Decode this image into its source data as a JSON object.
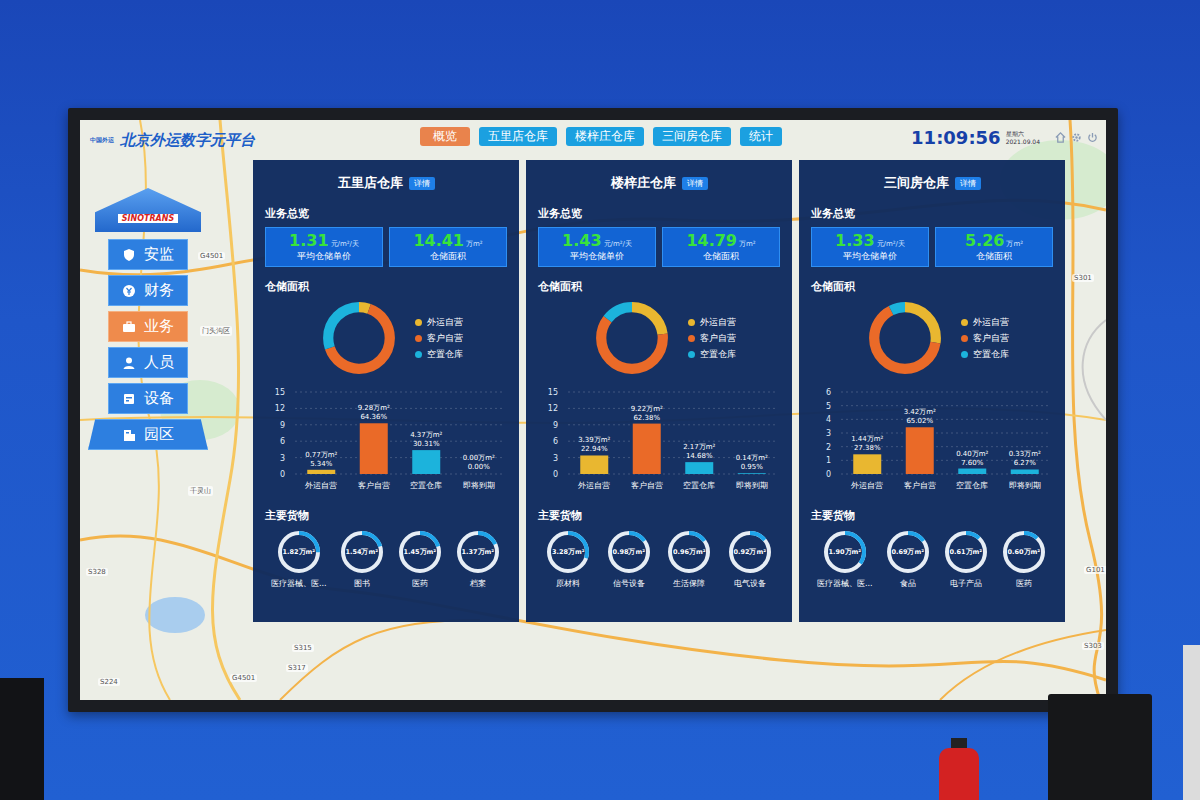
{
  "header": {
    "logo_text": "中国外运",
    "title": "北京外运数字元平台",
    "tabs": [
      {
        "label": "概览",
        "selected": true
      },
      {
        "label": "五里店仓库",
        "selected": false
      },
      {
        "label": "楼梓庄仓库",
        "selected": false
      },
      {
        "label": "三间房仓库",
        "selected": false
      },
      {
        "label": "统计",
        "selected": false
      }
    ],
    "time": "11:09:56",
    "weekday": "星期六",
    "date": "2021.09.04"
  },
  "sidebar": {
    "logo": "SINOTRANS",
    "items": [
      {
        "label": "安监",
        "selected": false
      },
      {
        "label": "财务",
        "selected": false
      },
      {
        "label": "业务",
        "selected": true
      },
      {
        "label": "人员",
        "selected": false
      },
      {
        "label": "设备",
        "selected": false
      },
      {
        "label": "园区",
        "selected": false
      }
    ]
  },
  "map": {
    "labels": [
      "G4501",
      "门头沟区",
      "千灵山",
      "S328",
      "S315",
      "S317",
      "G4501",
      "S301",
      "G101",
      "S303",
      "S224"
    ]
  },
  "legend": [
    {
      "label": "外运自营",
      "color": "#e9b730"
    },
    {
      "label": "客户自营",
      "color": "#ea6a28"
    },
    {
      "label": "空置仓库",
      "color": "#1cb3dc"
    }
  ],
  "panels": [
    {
      "name": "五里店仓库",
      "detail_button": "详情",
      "overview_title": "业务总览",
      "stats": [
        {
          "value": "1.31",
          "unit": "元/m²/天",
          "label": "平均仓储单价"
        },
        {
          "value": "14.41",
          "unit": "万m²",
          "label": "仓储面积"
        }
      ],
      "area_title": "仓储面积",
      "donut": [
        5.34,
        64.36,
        30.31
      ],
      "chart": {
        "ticks": [
          "15",
          "12",
          "9",
          "6",
          "3",
          "0"
        ],
        "bars": [
          {
            "label": "外运自营",
            "value": 0.77,
            "amount": "0.77万m²",
            "share": "5.34%",
            "color": "#e9b730"
          },
          {
            "label": "客户自营",
            "value": 9.28,
            "amount": "9.28万m²",
            "share": "64.36%",
            "color": "#ea6a28"
          },
          {
            "label": "空置仓库",
            "value": 4.37,
            "amount": "4.37万m²",
            "share": "30.31%",
            "color": "#1cb3dc"
          },
          {
            "label": "即将到期",
            "value": 0.0,
            "amount": "0.00万m²",
            "share": "0.00%",
            "color": "#1cb3dc"
          }
        ]
      },
      "goods_title": "主要货物",
      "goods": [
        {
          "value": "1.82万m²",
          "label": "医疗器械、医...",
          "level": 0.25
        },
        {
          "value": "1.54万m²",
          "label": "图书",
          "level": 0.2
        },
        {
          "value": "1.45万m²",
          "label": "医药",
          "level": 0.2
        },
        {
          "value": "1.37万m²",
          "label": "档案",
          "level": 0.18
        }
      ]
    },
    {
      "name": "楼梓庄仓库",
      "detail_button": "详情",
      "overview_title": "业务总览",
      "stats": [
        {
          "value": "1.43",
          "unit": "元/m²/天",
          "label": "平均仓储单价"
        },
        {
          "value": "14.79",
          "unit": "万m²",
          "label": "仓储面积"
        }
      ],
      "area_title": "仓储面积",
      "donut": [
        22.94,
        62.38,
        14.68
      ],
      "chart": {
        "ticks": [
          "15",
          "12",
          "9",
          "6",
          "3",
          "0"
        ],
        "bars": [
          {
            "label": "外运自营",
            "value": 3.39,
            "amount": "3.39万m²",
            "share": "22.94%",
            "color": "#e9b730"
          },
          {
            "label": "客户自营",
            "value": 9.22,
            "amount": "9.22万m²",
            "share": "62.38%",
            "color": "#ea6a28"
          },
          {
            "label": "空置仓库",
            "value": 2.17,
            "amount": "2.17万m²",
            "share": "14.68%",
            "color": "#1cb3dc"
          },
          {
            "label": "即将到期",
            "value": 0.14,
            "amount": "0.14万m²",
            "share": "0.95%",
            "color": "#1cb3dc"
          }
        ]
      },
      "goods_title": "主要货物",
      "goods": [
        {
          "value": "3.28万m²",
          "label": "原材料",
          "level": 0.3
        },
        {
          "value": "0.98万m²",
          "label": "信号设备",
          "level": 0.15
        },
        {
          "value": "0.96万m²",
          "label": "生活保障",
          "level": 0.15
        },
        {
          "value": "0.92万m²",
          "label": "电气设备",
          "level": 0.14
        }
      ]
    },
    {
      "name": "三间房仓库",
      "detail_button": "详情",
      "overview_title": "业务总览",
      "stats": [
        {
          "value": "1.33",
          "unit": "元/m²/天",
          "label": "平均仓储单价"
        },
        {
          "value": "5.26",
          "unit": "万m²",
          "label": "仓储面积"
        }
      ],
      "area_title": "仓储面积",
      "donut": [
        27.38,
        65.02,
        7.6
      ],
      "chart": {
        "ticks": [
          "6",
          "5",
          "4",
          "3",
          "2",
          "1",
          "0"
        ],
        "bars": [
          {
            "label": "外运自营",
            "value": 1.44,
            "amount": "1.44万m²",
            "share": "27.38%",
            "color": "#e9b730"
          },
          {
            "label": "客户自营",
            "value": 3.42,
            "amount": "3.42万m²",
            "share": "65.02%",
            "color": "#ea6a28"
          },
          {
            "label": "空置仓库",
            "value": 0.4,
            "amount": "0.40万m²",
            "share": "7.60%",
            "color": "#1cb3dc"
          },
          {
            "label": "即将到期",
            "value": 0.33,
            "amount": "0.33万m²",
            "share": "6.27%",
            "color": "#1cb3dc"
          }
        ]
      },
      "goods_title": "主要货物",
      "goods": [
        {
          "value": "1.90万m²",
          "label": "医疗器械、医...",
          "level": 0.35
        },
        {
          "value": "0.69万m²",
          "label": "食品",
          "level": 0.15
        },
        {
          "value": "0.61万m²",
          "label": "电子产品",
          "level": 0.12
        },
        {
          "value": "0.60万m²",
          "label": "医药",
          "level": 0.12
        }
      ]
    }
  ]
}
